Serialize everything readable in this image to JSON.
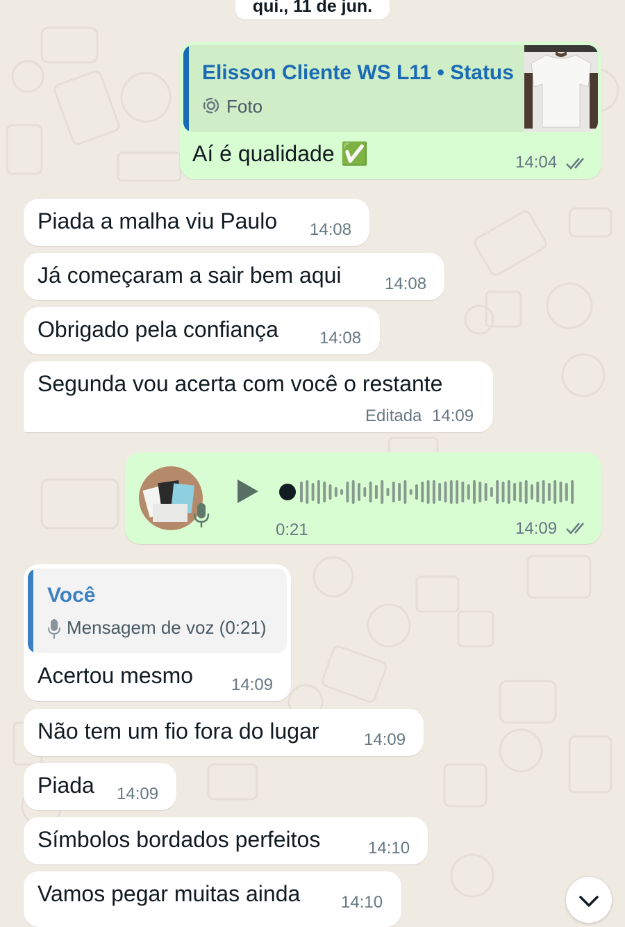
{
  "chat": {
    "date_separator": "qui., 11 de jun.",
    "messages": [
      {
        "id": "m1",
        "direction": "out",
        "quote": {
          "title": "Elisson Cliente WS L11 • Status",
          "subtitle": "Foto",
          "thumb": "white-tshirt-photo"
        },
        "text": "Aí é qualidade ✅",
        "time": "14:04",
        "read_ticks": "double-check"
      },
      {
        "id": "m2",
        "direction": "in",
        "text": "Piada a malha viu Paulo",
        "time": "14:08"
      },
      {
        "id": "m3",
        "direction": "in",
        "text": "Já começaram a sair bem aqui",
        "time": "14:08"
      },
      {
        "id": "m4",
        "direction": "in",
        "text": "Obrigado pela confiança",
        "time": "14:08"
      },
      {
        "id": "m5",
        "direction": "in",
        "text": "Segunda vou acerta com você o restante",
        "edited_label": "Editada",
        "time": "14:09"
      },
      {
        "id": "m6",
        "direction": "out",
        "type": "voice",
        "duration": "0:21",
        "time": "14:09",
        "read_ticks": "double-check",
        "avatar": "tshirts-photo"
      },
      {
        "id": "m7",
        "direction": "in",
        "quote": {
          "title": "Você",
          "subtitle": "Mensagem de voz (0:21)"
        },
        "text": "Acertou mesmo",
        "time": "14:09"
      },
      {
        "id": "m8",
        "direction": "in",
        "text": "Não tem um fio fora do lugar",
        "time": "14:09"
      },
      {
        "id": "m9",
        "direction": "in",
        "text": "Piada",
        "time": "14:09"
      },
      {
        "id": "m10",
        "direction": "in",
        "text": "Símbolos bordados perfeitos",
        "time": "14:10"
      },
      {
        "id": "m11",
        "direction": "in",
        "text": "Vamos pegar muitas ainda",
        "time": "14:10"
      }
    ]
  },
  "colors": {
    "background": "#efeae2",
    "incoming_bubble": "#ffffff",
    "outgoing_bubble": "#d9fdd3",
    "quote_accent_blue": "#1a6ab5",
    "quote_title_status": "#1a6ab5",
    "quote_title_you": "#3b80c0",
    "timestamp": "#667781",
    "ticks": "#667781"
  },
  "icons": {
    "status": "status-ring-icon",
    "mic": "microphone-icon",
    "play": "play-icon",
    "scroll_down": "chevron-down-icon"
  }
}
